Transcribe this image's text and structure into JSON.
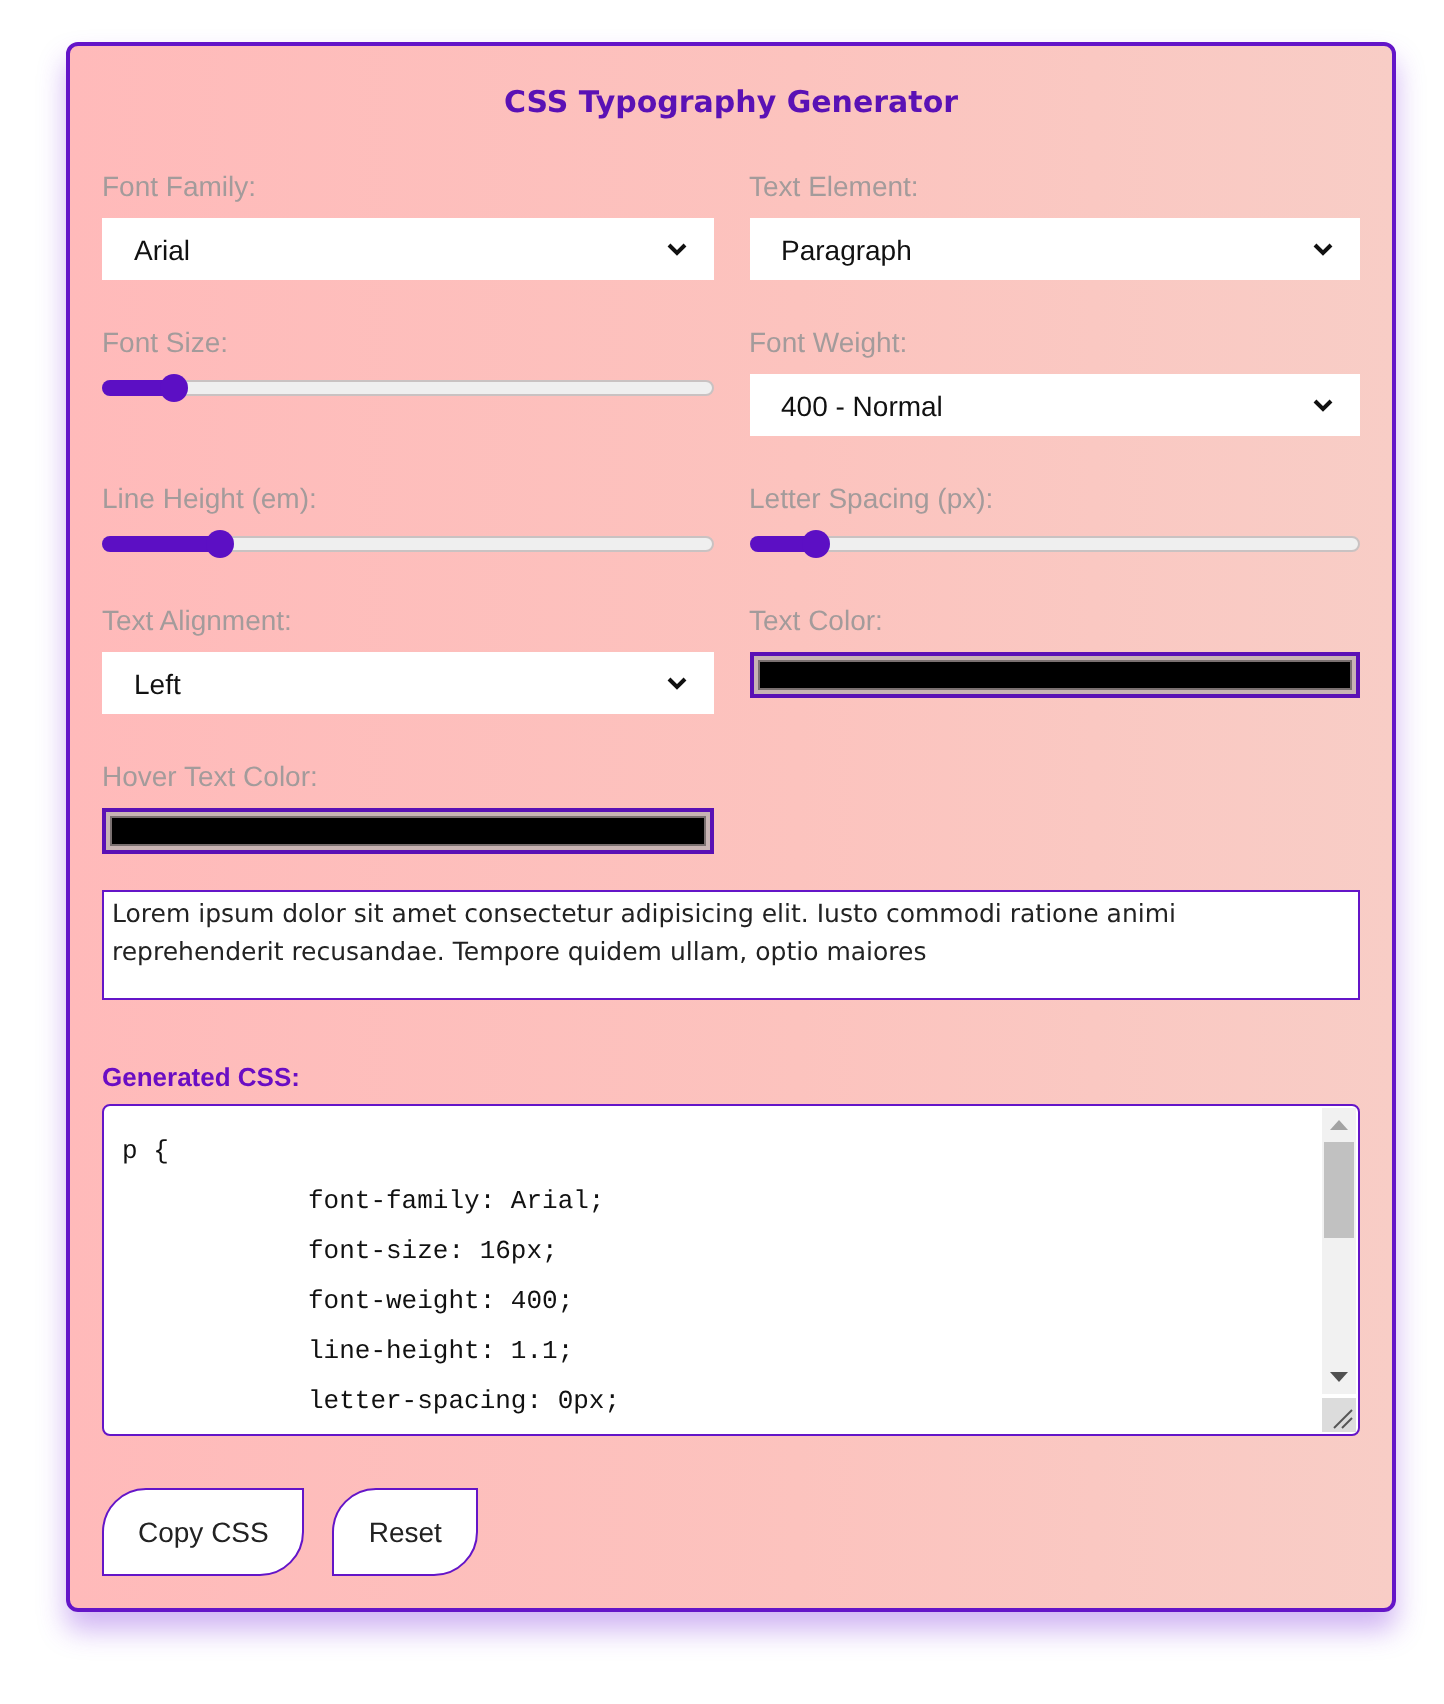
{
  "title": "CSS Typography Generator",
  "controls": [
    {
      "kind": "select",
      "label": "Font Family:",
      "value": "Arial"
    },
    {
      "kind": "select",
      "label": "Text Element:",
      "value": "Paragraph"
    },
    {
      "kind": "slider",
      "label": "Font Size:",
      "level": 0.1
    },
    {
      "kind": "select",
      "label": "Font Weight:",
      "value": "400 - Normal"
    },
    {
      "kind": "slider",
      "label": "Line Height (em):",
      "level": 0.18
    },
    {
      "kind": "slider",
      "label": "Letter Spacing (px):",
      "level": 0.09
    },
    {
      "kind": "select",
      "label": "Text Alignment:",
      "value": "Left"
    },
    {
      "kind": "color",
      "label": "Text Color:",
      "color": "#000000"
    },
    {
      "kind": "color",
      "label": "Hover Text Color:",
      "color": "#000000"
    }
  ],
  "preview": {
    "text": "Lorem ipsum dolor sit amet consectetur adipisicing elit. Iusto commodi ratione animi reprehenderit recusandae. Tempore quidem ullam, optio maiores"
  },
  "output": {
    "label": "Generated CSS:",
    "selector_line": "p {",
    "declarations": [
      "font-family: Arial;",
      "font-size: 16px;",
      "font-weight: 400;",
      "line-height: 1.1;",
      "letter-spacing: 0px;"
    ]
  },
  "buttons": [
    "Copy CSS",
    "Reset"
  ]
}
